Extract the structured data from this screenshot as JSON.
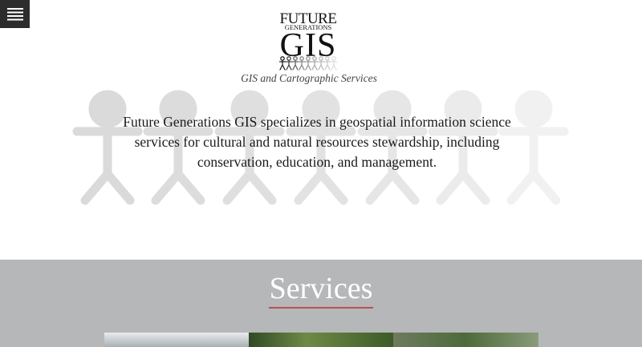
{
  "logo": {
    "line1": "FUTURE",
    "line2": "GENERATIONS",
    "line3": "GIS"
  },
  "tagline": "GIS and Cartographic Services",
  "hero": {
    "text": "Future Generations GIS specializes in geospatial information science services for cultural and natural resources stewardship, including conservation, education, and management."
  },
  "services": {
    "title": "Services"
  },
  "colors": {
    "menu_bg": "#2c2c2c",
    "services_bg": "#b6b7b9",
    "underline": "#b85058"
  },
  "icons": [
    "menu-icon",
    "people-figures-icon"
  ]
}
